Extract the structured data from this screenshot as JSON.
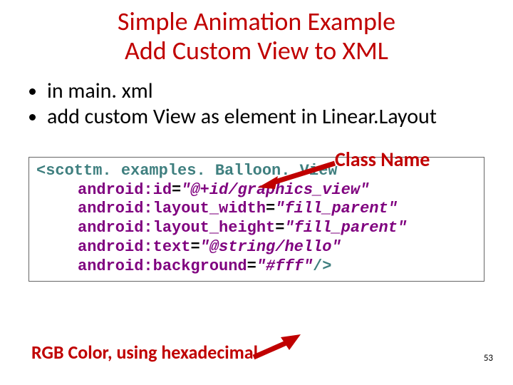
{
  "title_line1": "Simple Animation Example",
  "title_line2": "Add Custom View to XML",
  "bullets": {
    "b1": "in main. xml",
    "b2": "add custom View as element in Linear.Layout"
  },
  "label_classname": "Class Name",
  "label_rgb": "RGB Color, using hexadecimal",
  "page": "53",
  "code": {
    "open": "<",
    "tag": "scottm. examples. Balloon. View",
    "a1": "android:id",
    "v1": "\"@+id/graphics_view\"",
    "a2": "android:layout_width",
    "v2": "\"fill_parent\"",
    "a3": "android:layout_height",
    "v3": "\"fill_parent\"",
    "a4": "android:text",
    "v4": "\"@string/hello\"",
    "a5": "android:background",
    "v5": "\"#fff\"",
    "eq": "=",
    "close": "/>"
  }
}
